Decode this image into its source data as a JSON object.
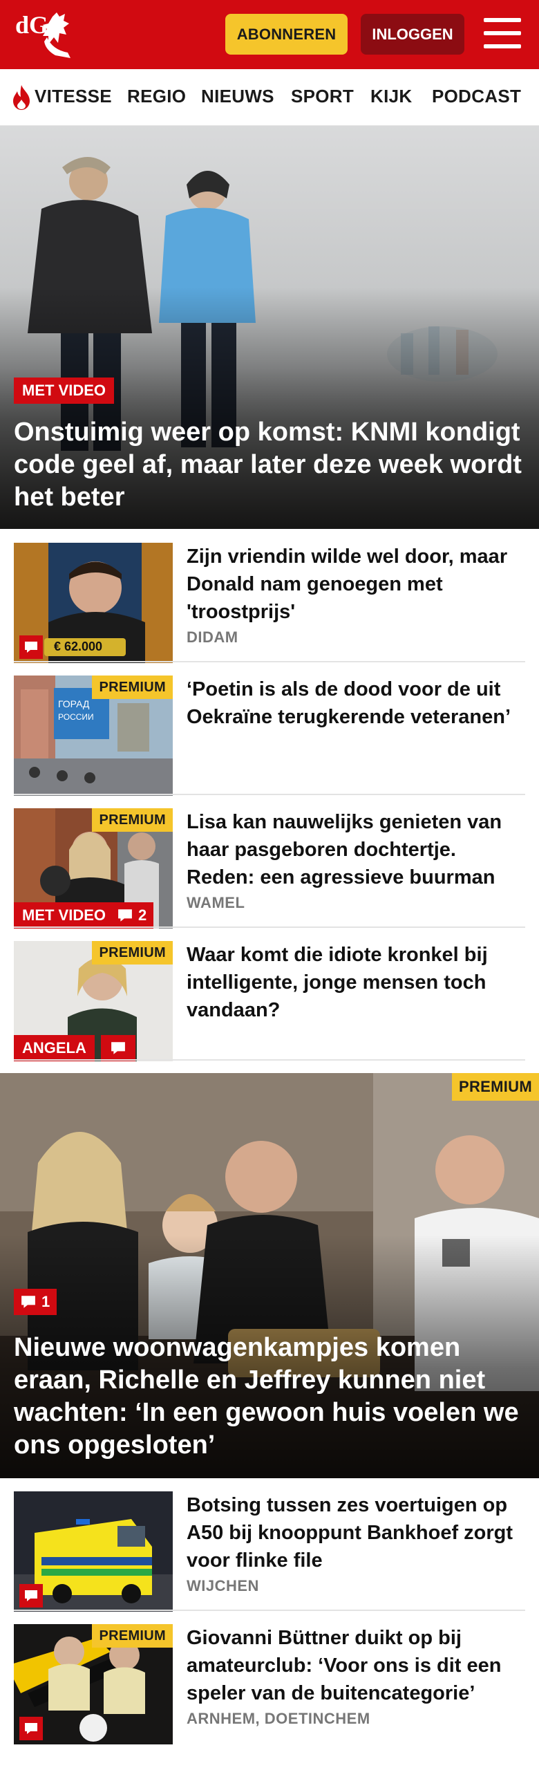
{
  "header": {
    "logo_text": "dG",
    "subscribe_label": "ABONNEREN",
    "login_label": "INLOGGEN",
    "brand_color": "#d10a11",
    "subscribe_color": "#f5c52b"
  },
  "nav": {
    "items": [
      "VITESSE",
      "REGIO",
      "NIEUWS",
      "SPORT",
      "KIJK",
      "PODCAST"
    ]
  },
  "hero1": {
    "label": "MET VIDEO",
    "title": "Onstuimig weer op komst: KNMI kondigt code geel af, maar later deze week wordt het beter"
  },
  "articles": [
    {
      "title": "Zijn vriendin wilde wel door, maar Donald nam genoegen met 'troostprijs'",
      "place": "DIDAM",
      "thumb_text": "€ 62.000"
    },
    {
      "title": "‘Poetin is als de dood voor de uit Oekraïne terugkerende veteranen’",
      "premium": "PREMIUM"
    },
    {
      "title": "Lisa kan nauwelijks genieten van haar pasgeboren dochtertje. Reden: een agressieve buurman",
      "place": "WAMEL",
      "premium": "PREMIUM",
      "label": "MET VIDEO",
      "comments": "2"
    },
    {
      "title": "Waar komt die idiote kronkel bij intelligente, jonge mensen toch vandaan?",
      "premium": "PREMIUM",
      "label": "ANGELA"
    }
  ],
  "hero2": {
    "premium": "PREMIUM",
    "comments": "1",
    "title": "Nieuwe woonwagenkampjes komen eraan, Richelle en Jeffrey kunnen niet wachten: ‘In een gewoon huis voelen we ons opgesloten’"
  },
  "articles2": [
    {
      "title": "Botsing tussen zes voertuigen op A50 bij knooppunt Bankhoef zorgt voor flinke file",
      "place": "WIJCHEN"
    },
    {
      "title": "Giovanni Büttner duikt op bij amateurclub: ‘Voor ons is dit een speler van de buitencategorie’",
      "place": "ARNHEM, DOETINCHEM",
      "premium": "PREMIUM"
    }
  ]
}
